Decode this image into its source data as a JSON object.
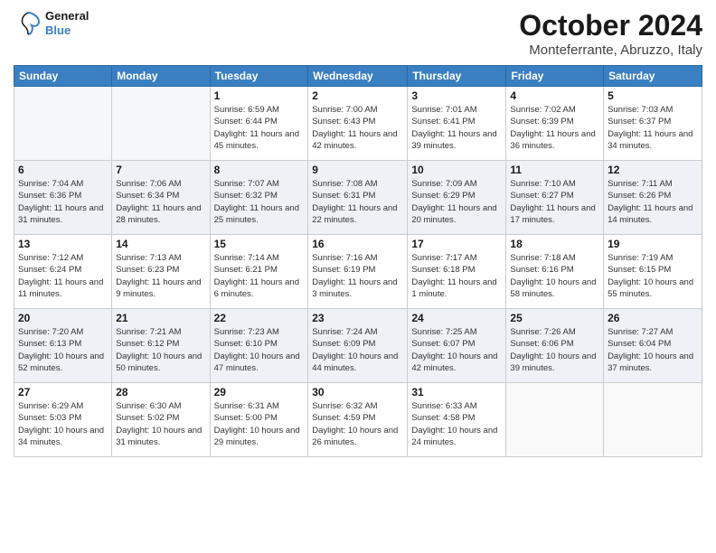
{
  "header": {
    "logo_general": "General",
    "logo_blue": "Blue",
    "month_title": "October 2024",
    "location": "Monteferrante, Abruzzo, Italy"
  },
  "days_of_week": [
    "Sunday",
    "Monday",
    "Tuesday",
    "Wednesday",
    "Thursday",
    "Friday",
    "Saturday"
  ],
  "weeks": [
    [
      {
        "day": "",
        "info": ""
      },
      {
        "day": "",
        "info": ""
      },
      {
        "day": "1",
        "info": "Sunrise: 6:59 AM\nSunset: 6:44 PM\nDaylight: 11 hours and 45 minutes."
      },
      {
        "day": "2",
        "info": "Sunrise: 7:00 AM\nSunset: 6:43 PM\nDaylight: 11 hours and 42 minutes."
      },
      {
        "day": "3",
        "info": "Sunrise: 7:01 AM\nSunset: 6:41 PM\nDaylight: 11 hours and 39 minutes."
      },
      {
        "day": "4",
        "info": "Sunrise: 7:02 AM\nSunset: 6:39 PM\nDaylight: 11 hours and 36 minutes."
      },
      {
        "day": "5",
        "info": "Sunrise: 7:03 AM\nSunset: 6:37 PM\nDaylight: 11 hours and 34 minutes."
      }
    ],
    [
      {
        "day": "6",
        "info": "Sunrise: 7:04 AM\nSunset: 6:36 PM\nDaylight: 11 hours and 31 minutes."
      },
      {
        "day": "7",
        "info": "Sunrise: 7:06 AM\nSunset: 6:34 PM\nDaylight: 11 hours and 28 minutes."
      },
      {
        "day": "8",
        "info": "Sunrise: 7:07 AM\nSunset: 6:32 PM\nDaylight: 11 hours and 25 minutes."
      },
      {
        "day": "9",
        "info": "Sunrise: 7:08 AM\nSunset: 6:31 PM\nDaylight: 11 hours and 22 minutes."
      },
      {
        "day": "10",
        "info": "Sunrise: 7:09 AM\nSunset: 6:29 PM\nDaylight: 11 hours and 20 minutes."
      },
      {
        "day": "11",
        "info": "Sunrise: 7:10 AM\nSunset: 6:27 PM\nDaylight: 11 hours and 17 minutes."
      },
      {
        "day": "12",
        "info": "Sunrise: 7:11 AM\nSunset: 6:26 PM\nDaylight: 11 hours and 14 minutes."
      }
    ],
    [
      {
        "day": "13",
        "info": "Sunrise: 7:12 AM\nSunset: 6:24 PM\nDaylight: 11 hours and 11 minutes."
      },
      {
        "day": "14",
        "info": "Sunrise: 7:13 AM\nSunset: 6:23 PM\nDaylight: 11 hours and 9 minutes."
      },
      {
        "day": "15",
        "info": "Sunrise: 7:14 AM\nSunset: 6:21 PM\nDaylight: 11 hours and 6 minutes."
      },
      {
        "day": "16",
        "info": "Sunrise: 7:16 AM\nSunset: 6:19 PM\nDaylight: 11 hours and 3 minutes."
      },
      {
        "day": "17",
        "info": "Sunrise: 7:17 AM\nSunset: 6:18 PM\nDaylight: 11 hours and 1 minute."
      },
      {
        "day": "18",
        "info": "Sunrise: 7:18 AM\nSunset: 6:16 PM\nDaylight: 10 hours and 58 minutes."
      },
      {
        "day": "19",
        "info": "Sunrise: 7:19 AM\nSunset: 6:15 PM\nDaylight: 10 hours and 55 minutes."
      }
    ],
    [
      {
        "day": "20",
        "info": "Sunrise: 7:20 AM\nSunset: 6:13 PM\nDaylight: 10 hours and 52 minutes."
      },
      {
        "day": "21",
        "info": "Sunrise: 7:21 AM\nSunset: 6:12 PM\nDaylight: 10 hours and 50 minutes."
      },
      {
        "day": "22",
        "info": "Sunrise: 7:23 AM\nSunset: 6:10 PM\nDaylight: 10 hours and 47 minutes."
      },
      {
        "day": "23",
        "info": "Sunrise: 7:24 AM\nSunset: 6:09 PM\nDaylight: 10 hours and 44 minutes."
      },
      {
        "day": "24",
        "info": "Sunrise: 7:25 AM\nSunset: 6:07 PM\nDaylight: 10 hours and 42 minutes."
      },
      {
        "day": "25",
        "info": "Sunrise: 7:26 AM\nSunset: 6:06 PM\nDaylight: 10 hours and 39 minutes."
      },
      {
        "day": "26",
        "info": "Sunrise: 7:27 AM\nSunset: 6:04 PM\nDaylight: 10 hours and 37 minutes."
      }
    ],
    [
      {
        "day": "27",
        "info": "Sunrise: 6:29 AM\nSunset: 5:03 PM\nDaylight: 10 hours and 34 minutes."
      },
      {
        "day": "28",
        "info": "Sunrise: 6:30 AM\nSunset: 5:02 PM\nDaylight: 10 hours and 31 minutes."
      },
      {
        "day": "29",
        "info": "Sunrise: 6:31 AM\nSunset: 5:00 PM\nDaylight: 10 hours and 29 minutes."
      },
      {
        "day": "30",
        "info": "Sunrise: 6:32 AM\nSunset: 4:59 PM\nDaylight: 10 hours and 26 minutes."
      },
      {
        "day": "31",
        "info": "Sunrise: 6:33 AM\nSunset: 4:58 PM\nDaylight: 10 hours and 24 minutes."
      },
      {
        "day": "",
        "info": ""
      },
      {
        "day": "",
        "info": ""
      }
    ]
  ]
}
